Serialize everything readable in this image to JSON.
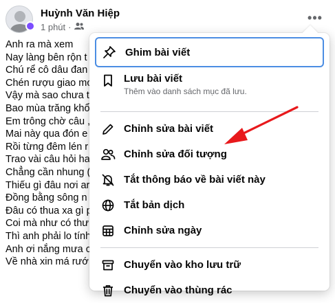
{
  "post": {
    "author": "Huỳnh Văn Hiệp",
    "time": "1 phút",
    "more_label": "•••",
    "lines": [
      "Anh ra mà xem",
      "Nay làng bên rộn t",
      "Chú rể cô dâu đan",
      "Chén rượu giao mo",
      "Vậy mà sao chưa t",
      "Bao mùa trăng khổ",
      "Em trông chờ câu ,",
      "Mai này qua đón e",
      "Rồi từng đêm lén r",
      "Trao vài câu hỏi ha",
      "Chẳng cần nhung (",
      "Thiếu gì đâu nơi ar",
      "Đồng bằng sông n",
      "Đâu có thua xa gì p",
      "Coi mà như có thư",
      "Thì anh phải lo tính",
      "Anh ơi nắng mưa c",
      "Về nhà xin má rướ"
    ]
  },
  "menu": {
    "items": [
      {
        "label": "Ghim bài viết",
        "icon": "pin-icon"
      },
      {
        "label": "Lưu bài viết",
        "sub": "Thêm vào danh sách mục đã lưu.",
        "icon": "bookmark-icon"
      },
      {
        "label": "Chỉnh sửa bài viết",
        "icon": "pencil-icon"
      },
      {
        "label": "Chỉnh sửa đối tượng",
        "icon": "people-icon"
      },
      {
        "label": "Tắt thông báo về bài viết này",
        "icon": "bell-off-icon"
      },
      {
        "label": "Tắt bản dịch",
        "icon": "globe-icon"
      },
      {
        "label": "Chỉnh sửa ngày",
        "icon": "calendar-icon"
      },
      {
        "label": "Chuyển vào kho lưu trữ",
        "icon": "archive-icon"
      },
      {
        "label": "Chuyển vào thùng rác",
        "icon": "trash-icon"
      }
    ]
  },
  "colors": {
    "focus_ring": "#4b8de3",
    "annotation_arrow": "#e8191c",
    "secondary_text": "#65676b"
  }
}
